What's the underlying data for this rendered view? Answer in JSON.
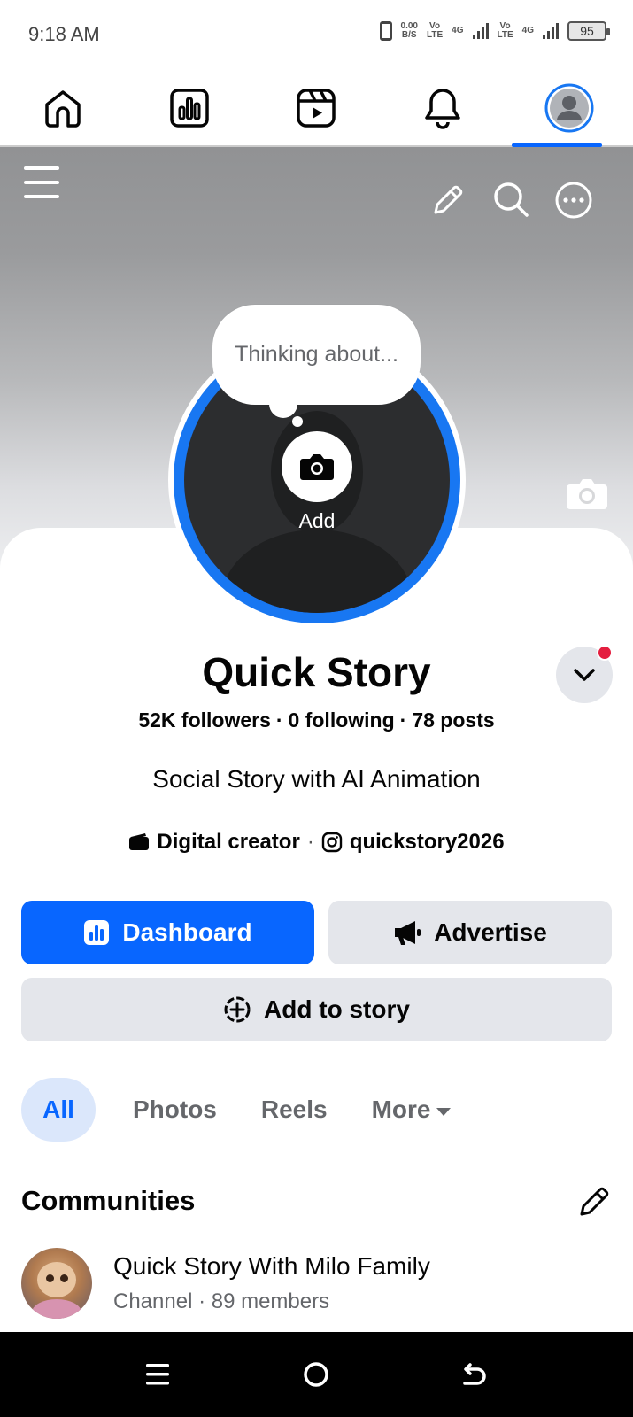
{
  "status_bar": {
    "time": "9:18 AM",
    "net_speed": "0.00",
    "net_unit": "B/S",
    "sim1_label": "Vo",
    "sim1_sub": "LTE",
    "sim1_net": "4G",
    "sim2_label": "Vo",
    "sim2_sub": "LTE",
    "sim2_net": "4G",
    "battery": "95"
  },
  "top_nav": {
    "items": [
      "home-icon",
      "dashboard-icon",
      "reels-icon",
      "bell-icon",
      "profile-icon"
    ],
    "active_index": 4,
    "accent": "#0866ff"
  },
  "cover": {
    "thought_bubble": "Thinking about...",
    "add_label": "Add"
  },
  "profile": {
    "name": "Quick Story",
    "followers": "52K followers",
    "following": "0 following",
    "posts": "78 posts",
    "separator": "·",
    "bio": "Social Story with AI Animation",
    "category": "Digital creator",
    "instagram": "quickstory2026"
  },
  "buttons": {
    "dashboard": "Dashboard",
    "advertise": "Advertise",
    "add_to_story": "Add to story"
  },
  "tabs": {
    "all": "All",
    "photos": "Photos",
    "reels": "Reels",
    "more": "More"
  },
  "communities": {
    "title": "Communities",
    "items": [
      {
        "name": "Quick Story With Milo Family",
        "sub": "Channel · 89 members"
      }
    ]
  },
  "colors": {
    "primary": "#0866ff",
    "button_gray": "#e4e6eb",
    "secondary_text": "#65676b",
    "notification_red": "#e41e3f"
  }
}
